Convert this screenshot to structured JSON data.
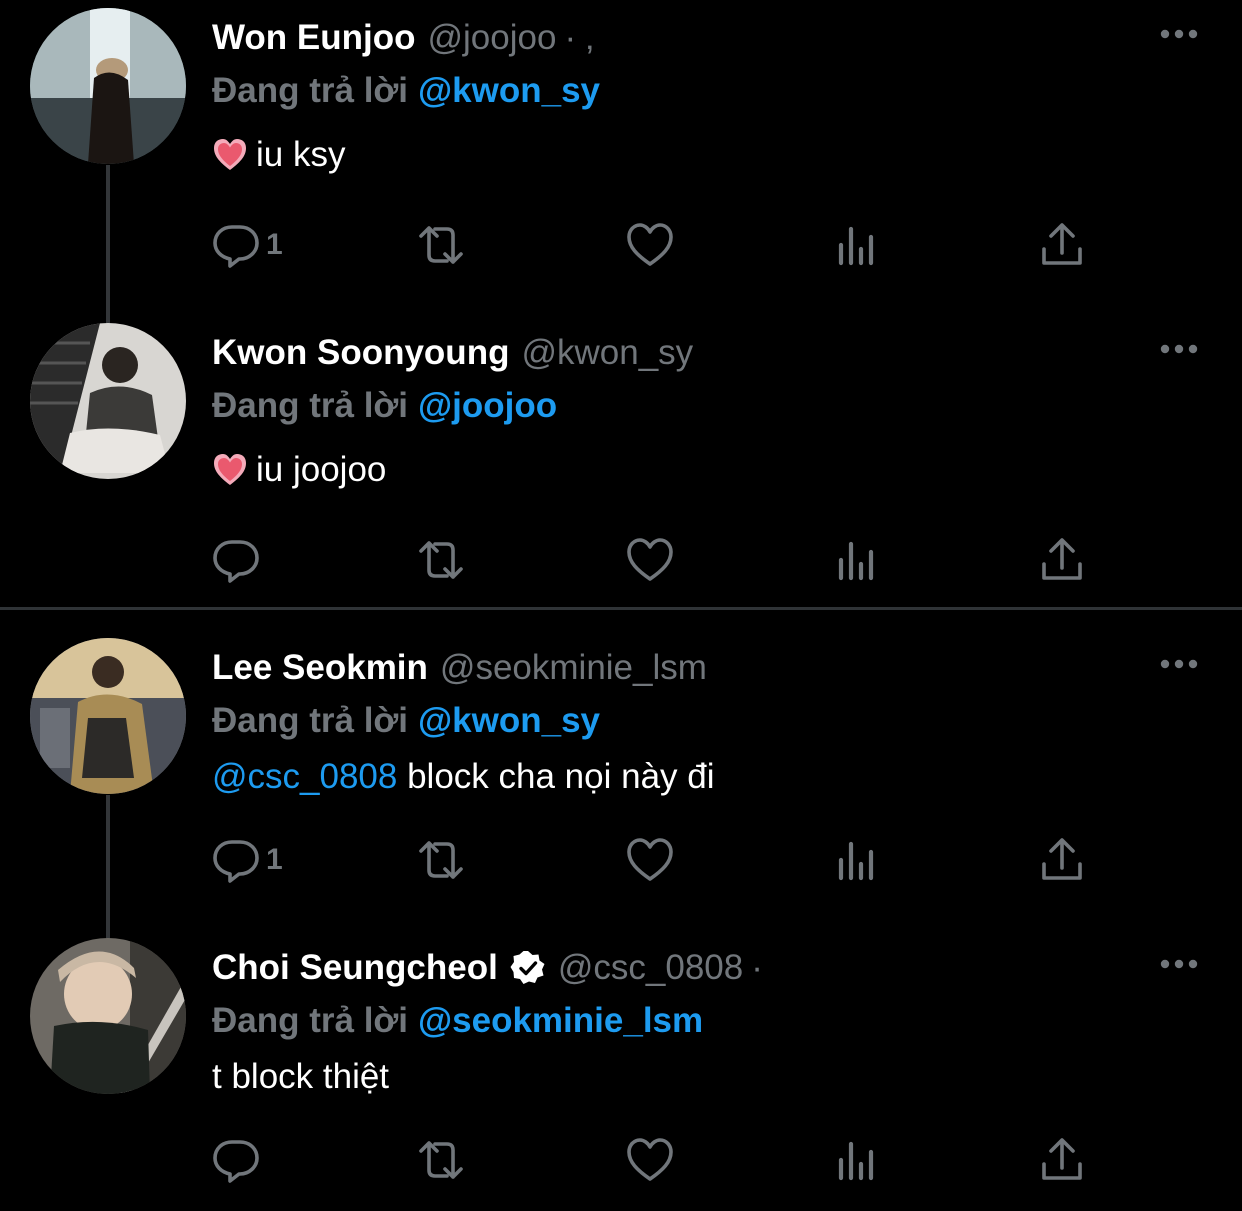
{
  "colors": {
    "background": "#000000",
    "name": "#ffffff",
    "muted": "#71767b",
    "link": "#1d9bf0",
    "verified": "#ffffff",
    "separator": "#2f3336"
  },
  "icons": {
    "reply": "reply-icon",
    "retweet": "retweet-icon",
    "like": "like-icon",
    "views": "views-icon",
    "share": "share-icon",
    "more": "more-icon",
    "verified": "verified-badge-icon",
    "emoji": "pink-heart-emoji"
  },
  "tweets": [
    {
      "display_name": "Won Eunjoo",
      "handle": "@joojoo",
      "dot": "· ‚",
      "reply_prefix": "Đang trả lời",
      "reply_to": "@kwon_sy",
      "emoji": "💗",
      "text": "iu ksy",
      "reply_count": "1",
      "verified": false
    },
    {
      "display_name": "Kwon Soonyoung",
      "handle": "@kwon_sy",
      "dot": "",
      "reply_prefix": "Đang trả lời",
      "reply_to": "@joojoo",
      "emoji": "💗",
      "text": "iu joojoo",
      "reply_count": "",
      "verified": false
    },
    {
      "display_name": "Lee Seokmin",
      "handle": "@seokminie_lsm",
      "dot": "",
      "reply_prefix": "Đang trả lời",
      "reply_to": "@kwon_sy",
      "mention": "@csc_0808",
      "text": " block cha nọi này đi",
      "reply_count": "1",
      "verified": false
    },
    {
      "display_name": "Choi Seungcheol",
      "handle": "@csc_0808",
      "dot": "·",
      "reply_prefix": "Đang trả lời",
      "reply_to": "@seokminie_lsm",
      "text": "t block thiệt",
      "reply_count": "",
      "verified": true
    }
  ]
}
